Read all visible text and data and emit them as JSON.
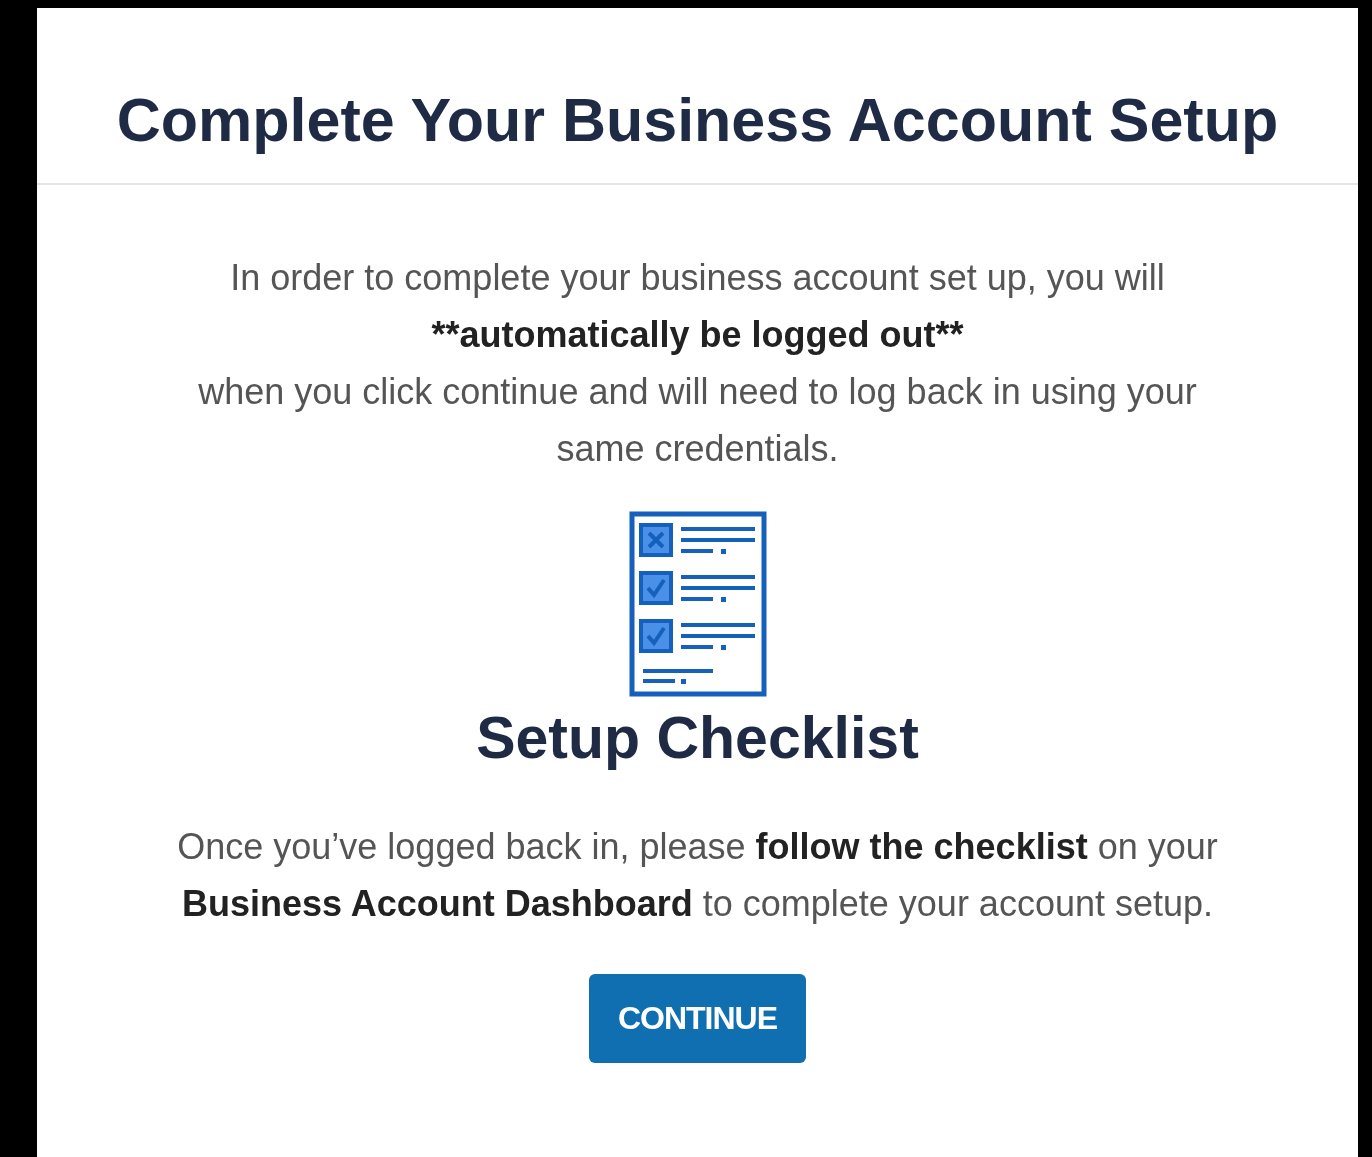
{
  "dialog": {
    "title": "Complete Your Business Account Setup",
    "notice": [
      {
        "text": "In order to complete your business account set up, you will",
        "bold": false
      },
      {
        "text": "**automatically be logged out**",
        "bold": true
      },
      {
        "text": "when you click continue and will need to log back in using your same credentials.",
        "bold": false
      }
    ],
    "checklist_title": "Setup Checklist",
    "instructions": "Once you’ve logged back in, please **follow the checklist** on your **Business Account Dashboard** to complete your account setup.",
    "button": "CONTINUE"
  }
}
